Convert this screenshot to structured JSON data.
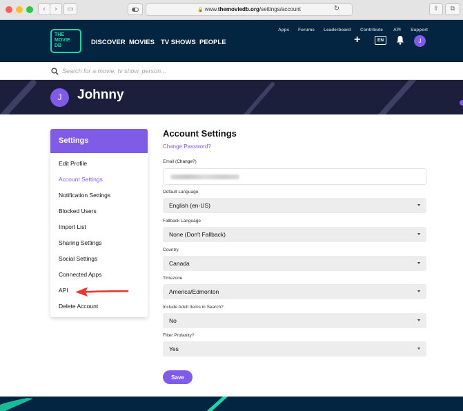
{
  "browser": {
    "url_prefix": "www.",
    "url_domain": "themoviedb.org",
    "url_path": "/settings/account"
  },
  "header": {
    "logo_lines": [
      "THE",
      "MOVIE",
      "DB"
    ],
    "nav": [
      "DISCOVER",
      "MOVIES",
      "TV SHOWS",
      "PEOPLE"
    ],
    "subnav": [
      "Apps",
      "Forums",
      "Leaderboard",
      "Contribute",
      "API",
      "Support"
    ],
    "plus": "+",
    "language": "EN",
    "avatar_letter": "J"
  },
  "search": {
    "placeholder": "Search for a movie, tv show, person..."
  },
  "profile": {
    "avatar_letter": "J",
    "name": "Johnny"
  },
  "settings_menu": {
    "title": "Settings",
    "items": [
      {
        "label": "Edit Profile"
      },
      {
        "label": "Account Settings"
      },
      {
        "label": "Notification Settings"
      },
      {
        "label": "Blocked Users"
      },
      {
        "label": "Import List"
      },
      {
        "label": "Sharing Settings"
      },
      {
        "label": "Social Settings"
      },
      {
        "label": "Connected Apps"
      },
      {
        "label": "API"
      },
      {
        "label": "Delete Account"
      }
    ]
  },
  "account": {
    "title": "Account Settings",
    "change_password": "Change Password?",
    "email_label": "Email (",
    "email_change": "Change?",
    "email_label_end": ")",
    "fields": [
      {
        "label": "Default Language",
        "value": "English (en-US)"
      },
      {
        "label": "Fallback Language",
        "value": "None (Don't Fallback)"
      },
      {
        "label": "Country",
        "value": "Canada"
      },
      {
        "label": "Timezone",
        "value": "America/Edmonton"
      },
      {
        "label": "Include Adult Items in Search?",
        "value": "No"
      },
      {
        "label": "Filter Profanity?",
        "value": "Yes"
      }
    ],
    "save": "Save"
  },
  "colors": {
    "accent": "#805be7",
    "header_bg": "#032541",
    "logo_green": "#1ed5a9",
    "arrow_red": "#e8372c"
  }
}
